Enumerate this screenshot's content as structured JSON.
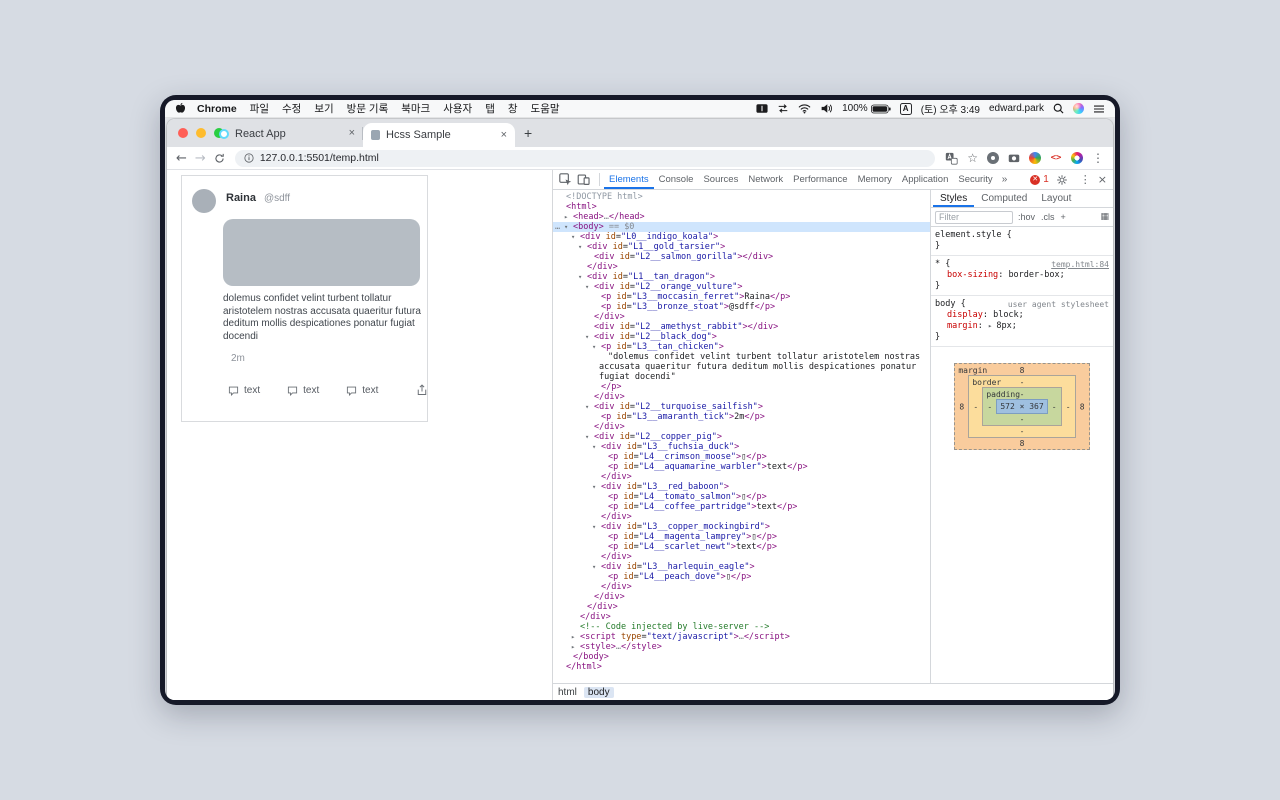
{
  "menubar": {
    "app_name": "Chrome",
    "menus": [
      "파일",
      "수정",
      "보기",
      "방문 기록",
      "북마크",
      "사용자",
      "탭",
      "창",
      "도움말"
    ],
    "battery": "100%",
    "input_source": "A",
    "datetime": "(토) 오후 3:49",
    "username": "edward.park"
  },
  "browser": {
    "tabs": [
      {
        "title": "React App"
      },
      {
        "title": "Hcss Sample"
      }
    ],
    "url": "127.0.0.1:5501/temp.html"
  },
  "page": {
    "name": "Raina",
    "handle": "@sdff",
    "body_text": "dolemus confidet velint turbent tollatur aristotelem nostras accusata quaeritur futura deditum mollis despicationes ponatur fugiat docendi",
    "timestamp": "2m",
    "action_labels": [
      "text",
      "text",
      "text"
    ]
  },
  "devtools": {
    "tabs": [
      "Elements",
      "Console",
      "Sources",
      "Network",
      "Performance",
      "Memory",
      "Application",
      "Security"
    ],
    "more_label": "»",
    "error_count": "1",
    "breadcrumbs": [
      "html",
      "body"
    ],
    "sidebar": {
      "tabs": [
        "Styles",
        "Computed",
        "Layout"
      ],
      "filter_placeholder": "Filter",
      "toggles": [
        ":hov",
        ".cls",
        "+"
      ],
      "rules": [
        {
          "selector": "element.style",
          "props": [],
          "link": "",
          "link_type": ""
        },
        {
          "selector": "*",
          "props": [
            {
              "name": "box-sizing",
              "value": "border-box"
            }
          ],
          "link": "temp.html:84",
          "link_type": "file"
        },
        {
          "selector": "body",
          "props": [
            {
              "name": "display",
              "value": "block"
            },
            {
              "name": "margin",
              "value": "8px",
              "expand": true
            }
          ],
          "link": "user agent stylesheet",
          "link_type": "note"
        }
      ],
      "box_model": {
        "margin": {
          "label": "margin",
          "top": "8",
          "right": "8",
          "bottom": "8",
          "left": "8"
        },
        "border": {
          "label": "border",
          "top": "-",
          "right": "-",
          "bottom": "-",
          "left": "-"
        },
        "padding": {
          "label": "padding",
          "top": "-",
          "right": "-",
          "bottom": "-",
          "left": "-"
        },
        "content": "572 × 367"
      }
    },
    "tree": [
      {
        "d": 0,
        "s": [
          [
            "g",
            "<!DOCTYPE html>"
          ]
        ]
      },
      {
        "d": 0,
        "s": [
          [
            "t",
            "<html>"
          ]
        ]
      },
      {
        "d": 1,
        "a": "r",
        "s": [
          [
            "t",
            "<head>"
          ],
          [
            "d",
            "…"
          ],
          [
            "t",
            "</head>"
          ]
        ]
      },
      {
        "d": 1,
        "a": "v",
        "h": 1,
        "g": "…",
        "s": [
          [
            "t",
            "<body>"
          ],
          [
            "d",
            " == $0"
          ]
        ]
      },
      {
        "d": 2,
        "a": "v",
        "s": [
          [
            "t",
            "<div"
          ],
          [
            "p",
            " "
          ],
          [
            "a",
            "id"
          ],
          [
            "p",
            "="
          ],
          [
            "v",
            "\"L0__indigo_koala\""
          ],
          [
            "t",
            ">"
          ]
        ]
      },
      {
        "d": 3,
        "a": "v",
        "s": [
          [
            "t",
            "<div"
          ],
          [
            "p",
            " "
          ],
          [
            "a",
            "id"
          ],
          [
            "p",
            "="
          ],
          [
            "v",
            "\"L1__gold_tarsier\""
          ],
          [
            "t",
            ">"
          ]
        ]
      },
      {
        "d": 4,
        "s": [
          [
            "t",
            "<div"
          ],
          [
            "p",
            " "
          ],
          [
            "a",
            "id"
          ],
          [
            "p",
            "="
          ],
          [
            "v",
            "\"L2__salmon_gorilla\""
          ],
          [
            "t",
            ">"
          ],
          [
            "t",
            "</div>"
          ]
        ]
      },
      {
        "d": 3,
        "s": [
          [
            "t",
            "</div>"
          ]
        ]
      },
      {
        "d": 3,
        "a": "v",
        "s": [
          [
            "t",
            "<div"
          ],
          [
            "p",
            " "
          ],
          [
            "a",
            "id"
          ],
          [
            "p",
            "="
          ],
          [
            "v",
            "\"L1__tan_dragon\""
          ],
          [
            "t",
            ">"
          ]
        ]
      },
      {
        "d": 4,
        "a": "v",
        "s": [
          [
            "t",
            "<div"
          ],
          [
            "p",
            " "
          ],
          [
            "a",
            "id"
          ],
          [
            "p",
            "="
          ],
          [
            "v",
            "\"L2__orange_vulture\""
          ],
          [
            "t",
            ">"
          ]
        ]
      },
      {
        "d": 5,
        "s": [
          [
            "t",
            "<p"
          ],
          [
            "p",
            " "
          ],
          [
            "a",
            "id"
          ],
          [
            "p",
            "="
          ],
          [
            "v",
            "\"L3__moccasin_ferret\""
          ],
          [
            "t",
            ">"
          ],
          [
            "x",
            "Raina"
          ],
          [
            "t",
            "</p>"
          ]
        ]
      },
      {
        "d": 5,
        "s": [
          [
            "t",
            "<p"
          ],
          [
            "p",
            " "
          ],
          [
            "a",
            "id"
          ],
          [
            "p",
            "="
          ],
          [
            "v",
            "\"L3__bronze_stoat\""
          ],
          [
            "t",
            ">"
          ],
          [
            "x",
            "@sdff"
          ],
          [
            "t",
            "</p>"
          ]
        ]
      },
      {
        "d": 4,
        "s": [
          [
            "t",
            "</div>"
          ]
        ]
      },
      {
        "d": 4,
        "s": [
          [
            "t",
            "<div"
          ],
          [
            "p",
            " "
          ],
          [
            "a",
            "id"
          ],
          [
            "p",
            "="
          ],
          [
            "v",
            "\"L2__amethyst_rabbit\""
          ],
          [
            "t",
            ">"
          ],
          [
            "t",
            "</div>"
          ]
        ]
      },
      {
        "d": 4,
        "a": "v",
        "s": [
          [
            "t",
            "<div"
          ],
          [
            "p",
            " "
          ],
          [
            "a",
            "id"
          ],
          [
            "p",
            "="
          ],
          [
            "v",
            "\"L2__black_dog\""
          ],
          [
            "t",
            ">"
          ]
        ]
      },
      {
        "d": 5,
        "a": "v",
        "s": [
          [
            "t",
            "<p"
          ],
          [
            "p",
            " "
          ],
          [
            "a",
            "id"
          ],
          [
            "p",
            "="
          ],
          [
            "v",
            "\"L3__tan_chicken\""
          ],
          [
            "t",
            ">"
          ]
        ]
      },
      {
        "d": 6,
        "w": 1,
        "s": [
          [
            "x",
            "\"dolemus confidet velint turbent tollatur aristotelem nostras accusata quaeritur futura deditum mollis despicationes ponatur fugiat docendi\""
          ]
        ]
      },
      {
        "d": 5,
        "s": [
          [
            "t",
            "</p>"
          ]
        ]
      },
      {
        "d": 4,
        "s": [
          [
            "t",
            "</div>"
          ]
        ]
      },
      {
        "d": 4,
        "a": "v",
        "s": [
          [
            "t",
            "<div"
          ],
          [
            "p",
            " "
          ],
          [
            "a",
            "id"
          ],
          [
            "p",
            "="
          ],
          [
            "v",
            "\"L2__turquoise_sailfish\""
          ],
          [
            "t",
            ">"
          ]
        ]
      },
      {
        "d": 5,
        "s": [
          [
            "t",
            "<p"
          ],
          [
            "p",
            " "
          ],
          [
            "a",
            "id"
          ],
          [
            "p",
            "="
          ],
          [
            "v",
            "\"L3__amaranth_tick\""
          ],
          [
            "t",
            ">"
          ],
          [
            "x",
            "2m"
          ],
          [
            "t",
            "</p>"
          ]
        ]
      },
      {
        "d": 4,
        "s": [
          [
            "t",
            "</div>"
          ]
        ]
      },
      {
        "d": 4,
        "a": "v",
        "s": [
          [
            "t",
            "<div"
          ],
          [
            "p",
            " "
          ],
          [
            "a",
            "id"
          ],
          [
            "p",
            "="
          ],
          [
            "v",
            "\"L2__copper_pig\""
          ],
          [
            "t",
            ">"
          ]
        ]
      },
      {
        "d": 5,
        "a": "v",
        "s": [
          [
            "t",
            "<div"
          ],
          [
            "p",
            " "
          ],
          [
            "a",
            "id"
          ],
          [
            "p",
            "="
          ],
          [
            "v",
            "\"L3__fuchsia_duck\""
          ],
          [
            "t",
            ">"
          ]
        ]
      },
      {
        "d": 6,
        "s": [
          [
            "t",
            "<p"
          ],
          [
            "p",
            " "
          ],
          [
            "a",
            "id"
          ],
          [
            "p",
            "="
          ],
          [
            "v",
            "\"L4__crimson_moose\""
          ],
          [
            "t",
            ">"
          ],
          [
            "x",
            "▯"
          ],
          [
            "t",
            "</p>"
          ]
        ]
      },
      {
        "d": 6,
        "s": [
          [
            "t",
            "<p"
          ],
          [
            "p",
            " "
          ],
          [
            "a",
            "id"
          ],
          [
            "p",
            "="
          ],
          [
            "v",
            "\"L4__aquamarine_warbler\""
          ],
          [
            "t",
            ">"
          ],
          [
            "x",
            "text"
          ],
          [
            "t",
            "</p>"
          ]
        ]
      },
      {
        "d": 5,
        "s": [
          [
            "t",
            "</div>"
          ]
        ]
      },
      {
        "d": 5,
        "a": "v",
        "s": [
          [
            "t",
            "<div"
          ],
          [
            "p",
            " "
          ],
          [
            "a",
            "id"
          ],
          [
            "p",
            "="
          ],
          [
            "v",
            "\"L3__red_baboon\""
          ],
          [
            "t",
            ">"
          ]
        ]
      },
      {
        "d": 6,
        "s": [
          [
            "t",
            "<p"
          ],
          [
            "p",
            " "
          ],
          [
            "a",
            "id"
          ],
          [
            "p",
            "="
          ],
          [
            "v",
            "\"L4__tomato_salmon\""
          ],
          [
            "t",
            ">"
          ],
          [
            "x",
            "▯"
          ],
          [
            "t",
            "</p>"
          ]
        ]
      },
      {
        "d": 6,
        "s": [
          [
            "t",
            "<p"
          ],
          [
            "p",
            " "
          ],
          [
            "a",
            "id"
          ],
          [
            "p",
            "="
          ],
          [
            "v",
            "\"L4__coffee_partridge\""
          ],
          [
            "t",
            ">"
          ],
          [
            "x",
            "text"
          ],
          [
            "t",
            "</p>"
          ]
        ]
      },
      {
        "d": 5,
        "s": [
          [
            "t",
            "</div>"
          ]
        ]
      },
      {
        "d": 5,
        "a": "v",
        "s": [
          [
            "t",
            "<div"
          ],
          [
            "p",
            " "
          ],
          [
            "a",
            "id"
          ],
          [
            "p",
            "="
          ],
          [
            "v",
            "\"L3__copper_mockingbird\""
          ],
          [
            "t",
            ">"
          ]
        ]
      },
      {
        "d": 6,
        "s": [
          [
            "t",
            "<p"
          ],
          [
            "p",
            " "
          ],
          [
            "a",
            "id"
          ],
          [
            "p",
            "="
          ],
          [
            "v",
            "\"L4__magenta_lamprey\""
          ],
          [
            "t",
            ">"
          ],
          [
            "x",
            "▯"
          ],
          [
            "t",
            "</p>"
          ]
        ]
      },
      {
        "d": 6,
        "s": [
          [
            "t",
            "<p"
          ],
          [
            "p",
            " "
          ],
          [
            "a",
            "id"
          ],
          [
            "p",
            "="
          ],
          [
            "v",
            "\"L4__scarlet_newt\""
          ],
          [
            "t",
            ">"
          ],
          [
            "x",
            "text"
          ],
          [
            "t",
            "</p>"
          ]
        ]
      },
      {
        "d": 5,
        "s": [
          [
            "t",
            "</div>"
          ]
        ]
      },
      {
        "d": 5,
        "a": "v",
        "s": [
          [
            "t",
            "<div"
          ],
          [
            "p",
            " "
          ],
          [
            "a",
            "id"
          ],
          [
            "p",
            "="
          ],
          [
            "v",
            "\"L3__harlequin_eagle\""
          ],
          [
            "t",
            ">"
          ]
        ]
      },
      {
        "d": 6,
        "s": [
          [
            "t",
            "<p"
          ],
          [
            "p",
            " "
          ],
          [
            "a",
            "id"
          ],
          [
            "p",
            "="
          ],
          [
            "v",
            "\"L4__peach_dove\""
          ],
          [
            "t",
            ">"
          ],
          [
            "x",
            "▯"
          ],
          [
            "t",
            "</p>"
          ]
        ]
      },
      {
        "d": 5,
        "s": [
          [
            "t",
            "</div>"
          ]
        ]
      },
      {
        "d": 4,
        "s": [
          [
            "t",
            "</div>"
          ]
        ]
      },
      {
        "d": 3,
        "s": [
          [
            "t",
            "</div>"
          ]
        ]
      },
      {
        "d": 2,
        "s": [
          [
            "t",
            "</div>"
          ]
        ]
      },
      {
        "d": 2,
        "s": [
          [
            "c",
            "<!-- Code injected by live-server -->"
          ]
        ]
      },
      {
        "d": 2,
        "a": "r",
        "s": [
          [
            "t",
            "<script"
          ],
          [
            "p",
            " "
          ],
          [
            "a",
            "type"
          ],
          [
            "p",
            "="
          ],
          [
            "v",
            "\"text/javascript\""
          ],
          [
            "t",
            ">"
          ],
          [
            "d",
            "…"
          ],
          [
            "t",
            "</script>"
          ]
        ]
      },
      {
        "d": 2,
        "a": "r",
        "s": [
          [
            "t",
            "<style>"
          ],
          [
            "d",
            "…"
          ],
          [
            "t",
            "</style>"
          ]
        ]
      },
      {
        "d": 1,
        "s": [
          [
            "t",
            "</body>"
          ]
        ]
      },
      {
        "d": 0,
        "s": [
          [
            "t",
            "</html>"
          ]
        ]
      }
    ]
  }
}
